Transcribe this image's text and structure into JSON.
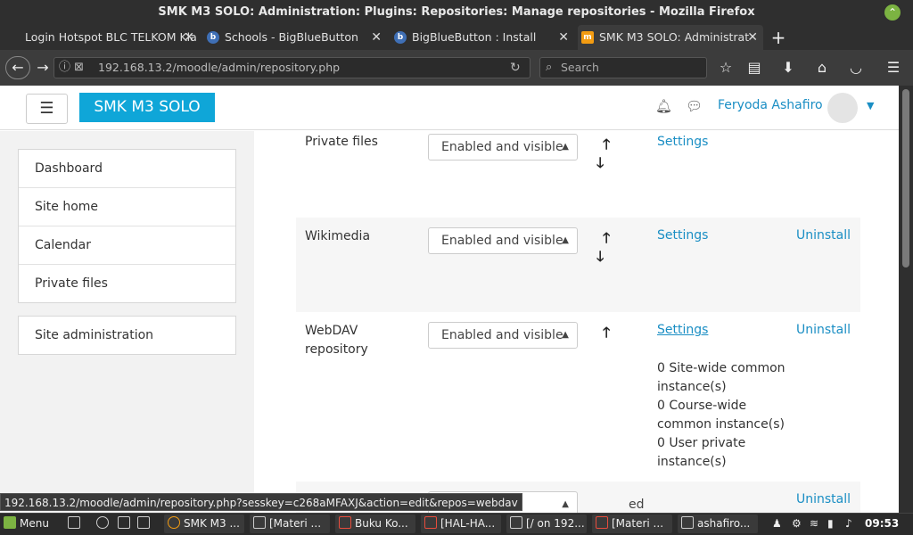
{
  "window": {
    "title": "SMK M3 SOLO: Administration: Plugins: Repositories: Manage repositories - Mozilla Firefox"
  },
  "tabs": [
    {
      "label": "Login Hotspot BLC TELKOM Kla",
      "active": false
    },
    {
      "label": "Schools - BigBlueButton",
      "active": false
    },
    {
      "label": "BigBlueButton : Install",
      "active": false
    },
    {
      "label": "SMK M3 SOLO: Administrat",
      "active": true
    }
  ],
  "nav": {
    "url": "192.168.13.2/moodle/admin/repository.php",
    "search_placeholder": "Search"
  },
  "header": {
    "brand": "SMK M3 SOLO",
    "username": "Feryoda Ashafiro"
  },
  "sidebar": {
    "items": [
      {
        "label": "Dashboard"
      },
      {
        "label": "Site home"
      },
      {
        "label": "Calendar"
      },
      {
        "label": "Private files"
      }
    ],
    "admin": "Site administration"
  },
  "repositories": [
    {
      "name_line1": "Private files",
      "name_line2": "",
      "status": "Enabled and visible",
      "settings": "Settings",
      "uninstall": ""
    },
    {
      "name_line1": "Wikimedia",
      "name_line2": "",
      "status": "Enabled and visible",
      "settings": "Settings",
      "uninstall": "Uninstall"
    },
    {
      "name_line1": "WebDAV",
      "name_line2": "repository",
      "status": "Enabled and visible",
      "settings": "Settings",
      "uninstall": "Uninstall",
      "info": [
        "0 Site-wide common",
        "instance(s)",
        "0 Course-wide",
        "common instance(s)",
        "0 User private",
        "instance(s)"
      ]
    },
    {
      "status": "ed",
      "uninstall": "Uninstall"
    }
  ],
  "status_url": "192.168.13.2/moodle/admin/repository.php?sesskey=c268aMFAXJ&action=edit&repos=webdav",
  "taskbar": {
    "menu": "Menu",
    "windows": [
      "SMK M3 ...",
      "[Materi ...",
      "Buku Ko...",
      "[HAL-HA...",
      "[/ on 192...",
      "[Materi ...",
      "ashafiro..."
    ],
    "clock": "09:53"
  }
}
